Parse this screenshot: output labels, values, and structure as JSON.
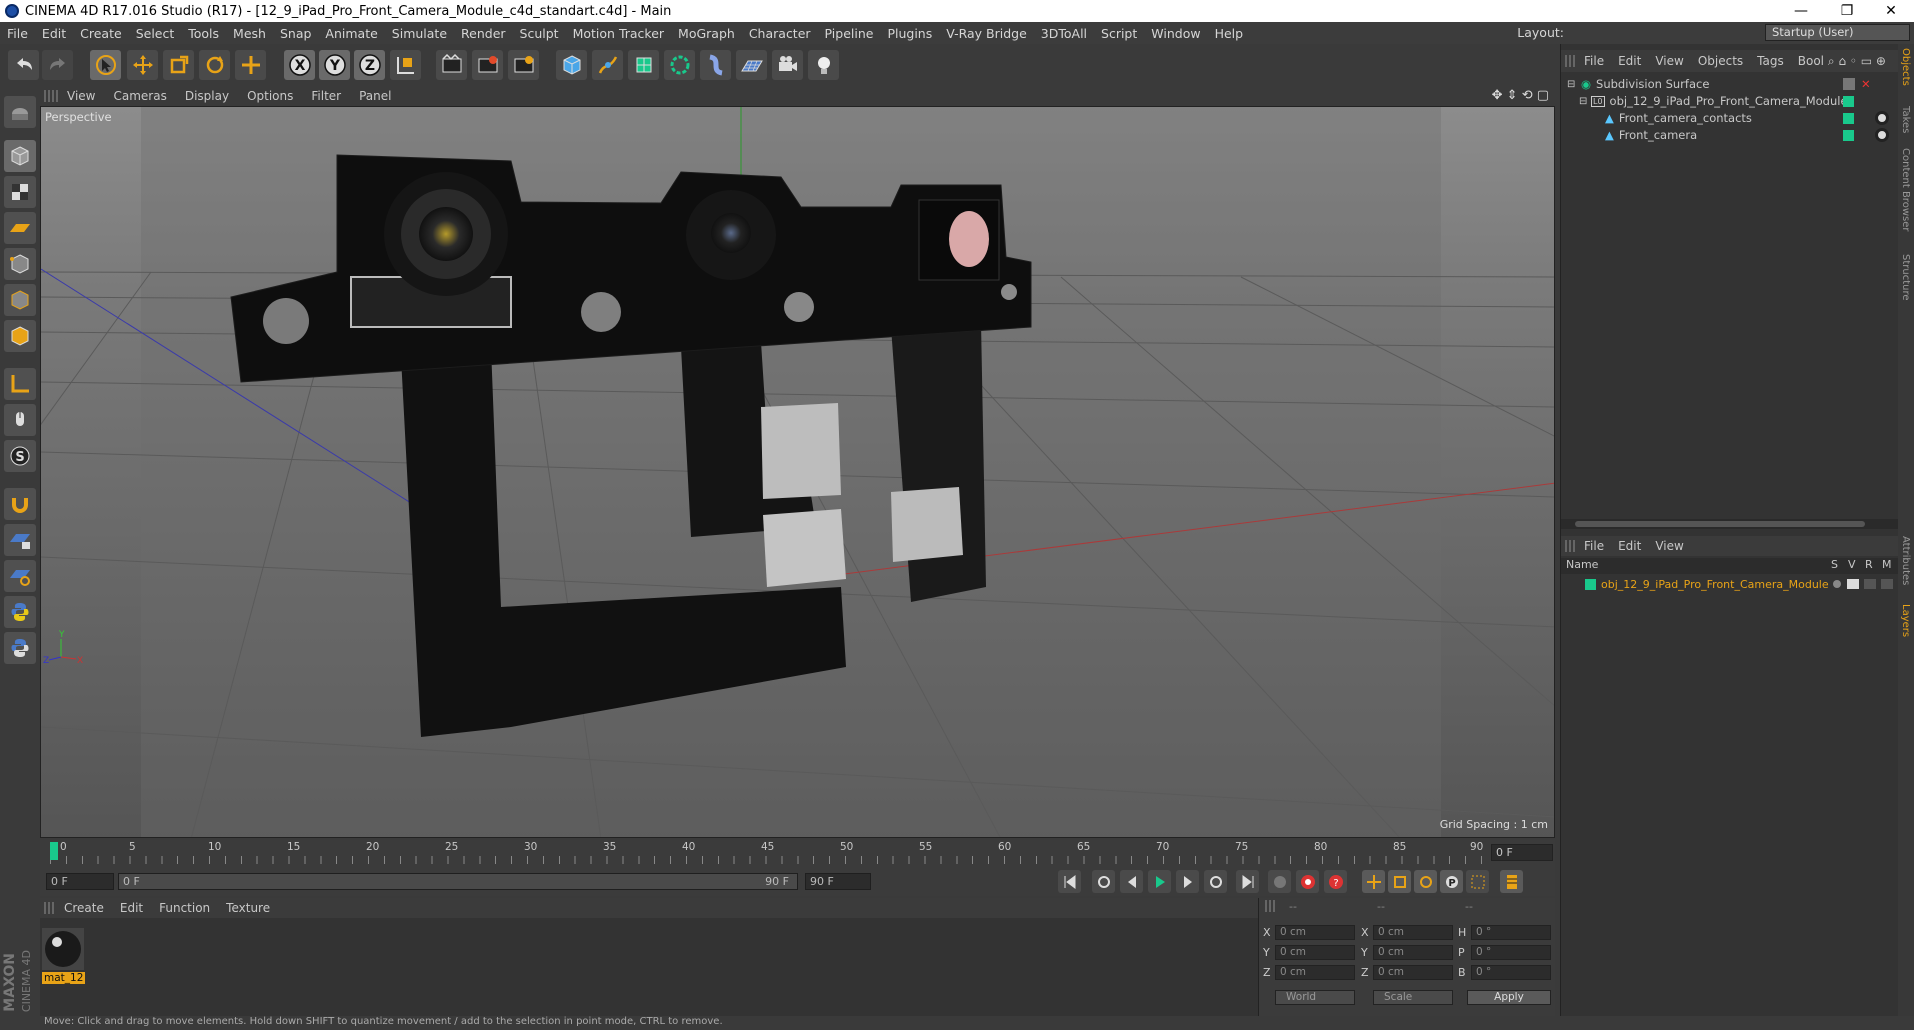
{
  "window": {
    "title": "CINEMA 4D R17.016 Studio (R17) - [12_9_iPad_Pro_Front_Camera_Module_c4d_standart.c4d] - Main",
    "minimize": "—",
    "restore": "❐",
    "close": "✕"
  },
  "menubar": {
    "items": [
      "File",
      "Edit",
      "Create",
      "Select",
      "Tools",
      "Mesh",
      "Snap",
      "Animate",
      "Simulate",
      "Render",
      "Sculpt",
      "Motion Tracker",
      "MoGraph",
      "Character",
      "Pipeline",
      "Plugins",
      "V-Ray Bridge",
      "3DToAll",
      "Script",
      "Window",
      "Help"
    ],
    "layout_label": "Layout:",
    "layout_value": "Startup (User)"
  },
  "toolbar": {
    "icons": [
      "undo-icon",
      "redo-icon",
      "select-arrow-icon",
      "move-icon",
      "scale-icon",
      "rotate-icon",
      "move-add-icon",
      "x-axis-icon",
      "y-axis-icon",
      "z-axis-icon",
      "coordinate-system-icon",
      "render-view-icon",
      "render-picture-viewer-icon",
      "render-settings-icon",
      "cube-icon",
      "pen-icon",
      "subdivision-icon",
      "array-icon",
      "deformer-icon",
      "floor-icon",
      "camera-icon",
      "light-icon"
    ]
  },
  "viewport": {
    "menu": [
      "View",
      "Cameras",
      "Display",
      "Options",
      "Filter",
      "Panel"
    ],
    "label": "Perspective",
    "grid_spacing": "Grid Spacing : 1 cm"
  },
  "timeline": {
    "ticks": [
      "0",
      "5",
      "10",
      "15",
      "20",
      "25",
      "30",
      "35",
      "40",
      "45",
      "50",
      "55",
      "60",
      "65",
      "70",
      "75",
      "80",
      "85",
      "90"
    ],
    "current_frame": "0 F"
  },
  "transport": {
    "start": "0 F",
    "range_start": "0 F",
    "range_end": "90 F",
    "end": "90 F"
  },
  "material_manager": {
    "menu": [
      "Create",
      "Edit",
      "Function",
      "Texture"
    ],
    "material_name": "mat_12"
  },
  "coordinates": {
    "headers": [
      "--",
      "--",
      "--"
    ],
    "rows": [
      {
        "axis": "X",
        "pos": "0 cm",
        "saxis": "X",
        "size": "0 cm",
        "raxis": "H",
        "rot": "0 °"
      },
      {
        "axis": "Y",
        "pos": "0 cm",
        "saxis": "Y",
        "size": "0 cm",
        "raxis": "P",
        "rot": "0 °"
      },
      {
        "axis": "Z",
        "pos": "0 cm",
        "saxis": "Z",
        "size": "0 cm",
        "raxis": "B",
        "rot": "0 °"
      }
    ],
    "mode": "World",
    "scale_mode": "Scale",
    "apply": "Apply"
  },
  "object_manager": {
    "menu": [
      "File",
      "Edit",
      "View",
      "Objects",
      "Tags",
      "Bool"
    ],
    "objects": [
      {
        "name": "Subdivision Surface",
        "indent": 0
      },
      {
        "name": "obj_12_9_iPad_Pro_Front_Camera_Module",
        "indent": 1
      },
      {
        "name": "Front_camera_contacts",
        "indent": 2
      },
      {
        "name": "Front_camera",
        "indent": 2
      }
    ]
  },
  "layer_manager": {
    "menu": [
      "File",
      "Edit",
      "View"
    ],
    "columns": [
      "Name",
      "S",
      "V",
      "R",
      "M"
    ],
    "layers": [
      {
        "name": "obj_12_9_iPad_Pro_Front_Camera_Module",
        "color": "#19c98c"
      }
    ]
  },
  "side_tabs": [
    "Objects",
    "Takes",
    "Content Browser",
    "Structure",
    "Attributes",
    "Layers"
  ],
  "status": "Move: Click and drag to move elements. Hold down SHIFT to quantize movement / add to the selection in point mode, CTRL to remove.",
  "brand": {
    "maxon": "MAXON",
    "c4d": "CINEMA 4D"
  },
  "colors": {
    "accent_orange": "#e8a317",
    "layer_green": "#19c98c"
  }
}
